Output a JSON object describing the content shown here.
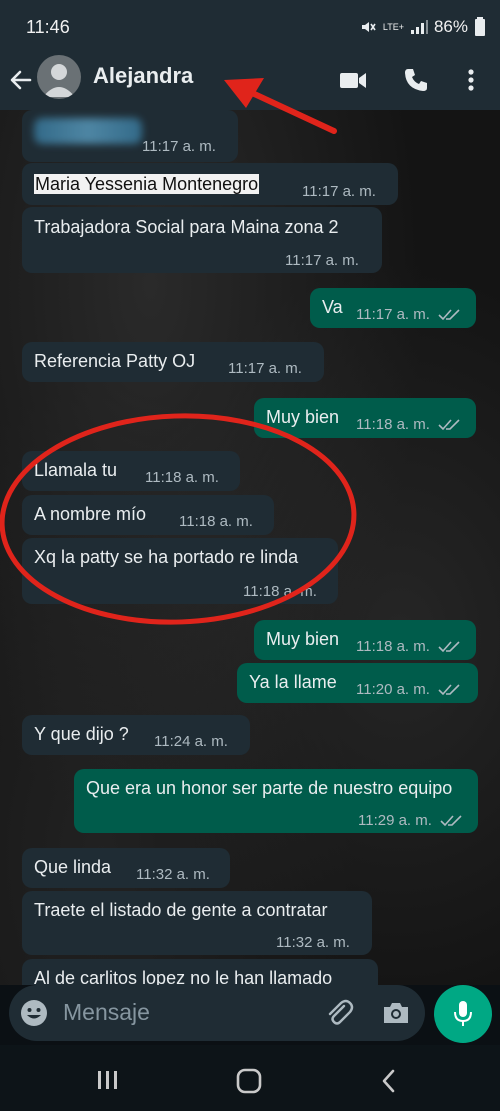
{
  "status": {
    "time": "11:46",
    "network": "LTE+",
    "battery": "86%"
  },
  "header": {
    "contact_name": "Alejandra"
  },
  "messages": [
    {
      "dir": "in",
      "text": "",
      "time": "11:17 a. m."
    },
    {
      "dir": "in",
      "text": "Maria Yessenia Montenegro",
      "time": "11:17 a. m."
    },
    {
      "dir": "in",
      "text": "Trabajadora Social para Maina zona 2",
      "time": "11:17 a. m."
    },
    {
      "dir": "out",
      "text": "Va",
      "time": "11:17 a. m."
    },
    {
      "dir": "in",
      "text": "Referencia Patty OJ",
      "time": "11:17 a. m."
    },
    {
      "dir": "out",
      "text": "Muy bien",
      "time": "11:18 a. m."
    },
    {
      "dir": "in",
      "text": "Llamala tu",
      "time": "11:18 a. m."
    },
    {
      "dir": "in",
      "text": "A nombre mío",
      "time": "11:18 a. m."
    },
    {
      "dir": "in",
      "text": "Xq la patty se ha portado re linda",
      "time": "11:18 a. m."
    },
    {
      "dir": "out",
      "text": "Muy bien",
      "time": "11:18 a. m."
    },
    {
      "dir": "out",
      "text": "Ya la llame",
      "time": "11:20 a. m."
    },
    {
      "dir": "in",
      "text": "Y que dijo ?",
      "time": "11:24 a. m."
    },
    {
      "dir": "out",
      "text": "Que era un honor ser parte de nuestro equipo",
      "time": "11:29 a. m."
    },
    {
      "dir": "in",
      "text": "Que linda",
      "time": "11:32 a. m."
    },
    {
      "dir": "in",
      "text": "Traete el listado de gente a contratar",
      "time": "11:32 a. m."
    },
    {
      "dir": "in",
      "text": "Al de carlitos lopez no le han llamado",
      "time": ""
    }
  ],
  "composer": {
    "placeholder": "Mensaje"
  },
  "annotations": {
    "color": "#e0241b"
  },
  "colors": {
    "incoming": "#1f2c34",
    "outgoing": "#005c4b",
    "accent": "#00a884",
    "read_ticks": "#53bdeb"
  }
}
